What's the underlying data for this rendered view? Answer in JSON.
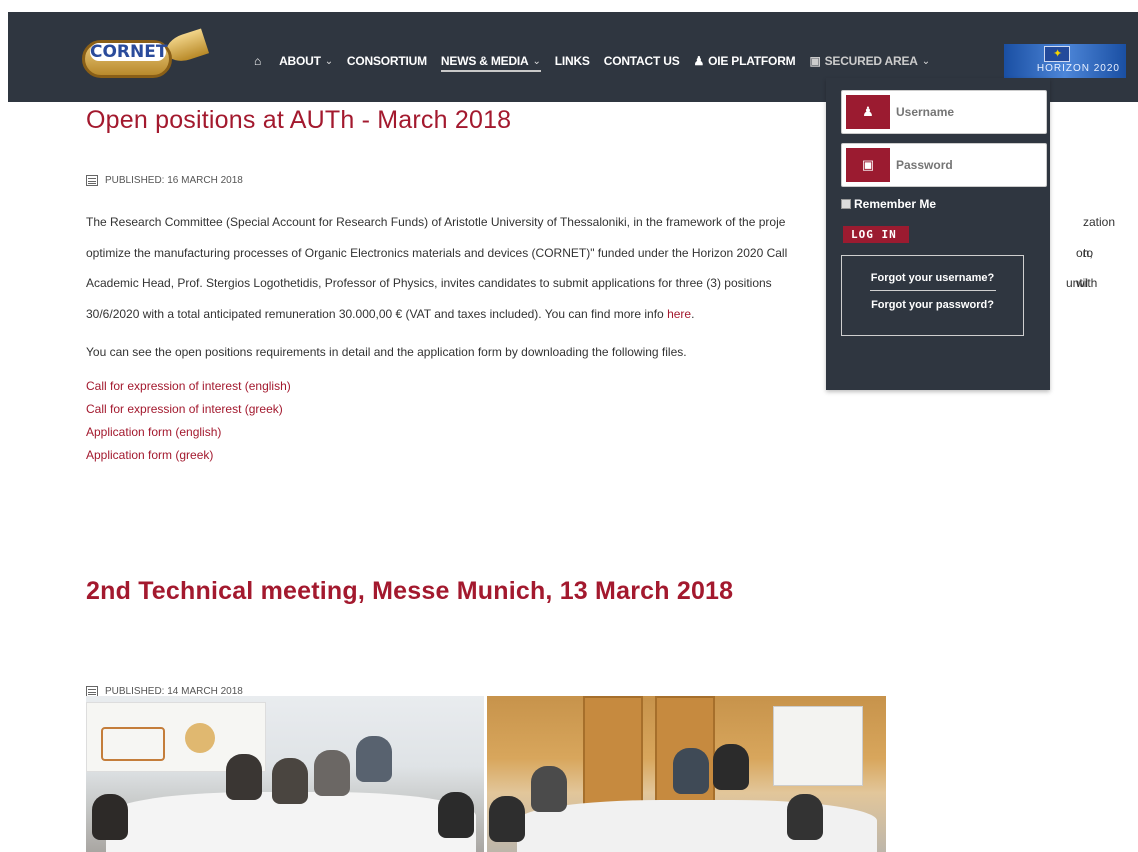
{
  "header": {
    "logo_text": "CORNET",
    "nav": [
      {
        "label": "",
        "icon": "home-icon"
      },
      {
        "label": "ABOUT",
        "dropdown": true
      },
      {
        "label": "CONSORTIUM"
      },
      {
        "label": "NEWS & MEDIA",
        "dropdown": true,
        "active": true
      },
      {
        "label": "LINKS"
      },
      {
        "label": "CONTACT US"
      },
      {
        "label": "OIE PLATFORM",
        "icon": "users-icon"
      },
      {
        "label": "SECURED AREA",
        "icon": "lock-icon",
        "dropdown": true
      }
    ],
    "horizon_text": "HORIZON 2020"
  },
  "login": {
    "username_placeholder": "Username",
    "password_placeholder": "Password",
    "remember_label": "Remember Me",
    "login_button": "LOG IN",
    "forgot_username": "Forgot your username?",
    "forgot_password": "Forgot your password?"
  },
  "article1": {
    "title": "Open positions at AUTh - March 2018",
    "published": "PUBLISHED: 16 MARCH 2018",
    "paragraph_line1": "The Research Committee (Special Account for Research Funds) of Aristotle University of Thessaloniki, in the framework of the proje",
    "paragraph_line1_end": "zation to",
    "paragraph_line2": "optimize the manufacturing processes of Organic Electronics materials and devices (CORNET)\" funded under the Horizon 2020 Call",
    "paragraph_line2_end": "on, with",
    "paragraph_line3": "Academic Head, Prof. Stergios Logothetidis, Professor of Physics, invites candidates to submit applications for three (3) positions",
    "paragraph_line3_end": "until",
    "paragraph_line4": "30/6/2020 with a total anticipated remuneration 30.000,00 € (VAT and taxes included). You can find more info ",
    "here_link": "here",
    "paragraph_line4_end": ".",
    "paragraph2": "You can see the open positions requirements in detail and the application form by downloading the following files.",
    "links": [
      "Call for expression of interest (english)",
      "Call for expression of interest (greek)",
      "Application form (english)",
      "Application form (greek)"
    ]
  },
  "article2": {
    "title": "2nd Technical meeting, Messe Munich, 13 March 2018",
    "published": "PUBLISHED: 14 MARCH 2018"
  }
}
